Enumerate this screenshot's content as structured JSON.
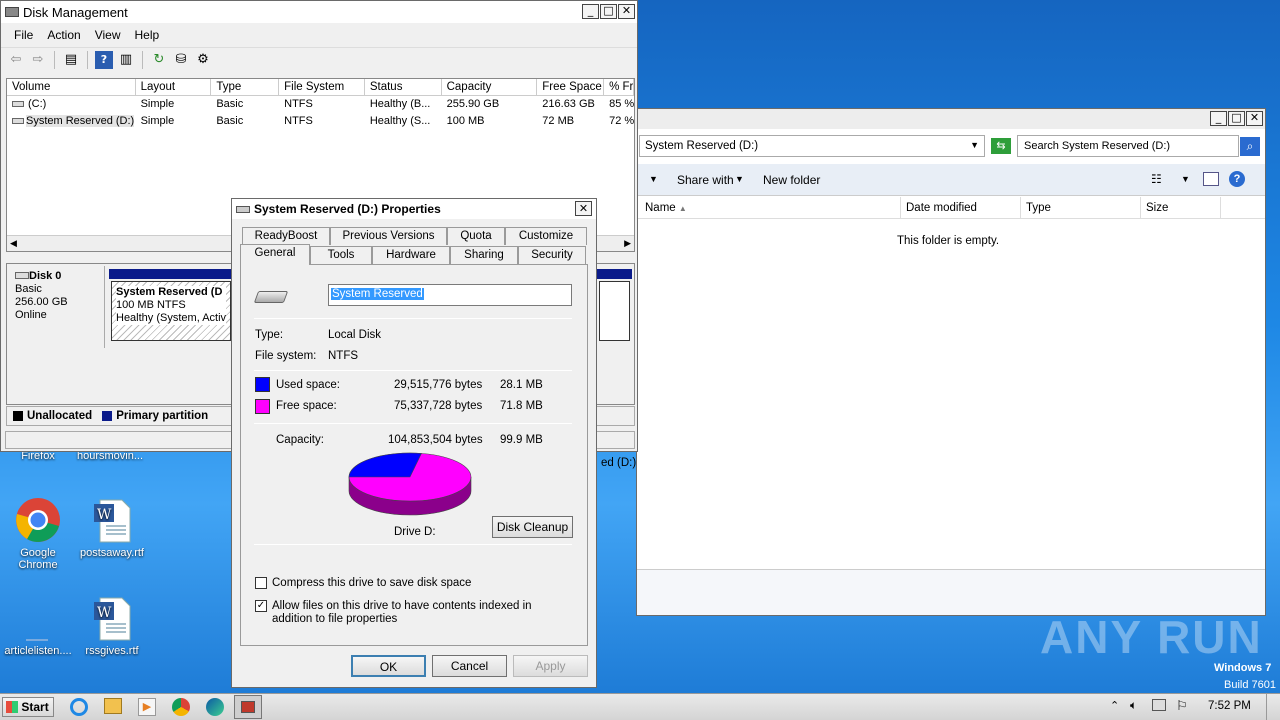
{
  "desktop": {
    "icons": [
      {
        "label": "Firefox"
      },
      {
        "label": "hoursmovin..."
      },
      {
        "label": "Google Chrome"
      },
      {
        "label": "postsaway.rtf"
      },
      {
        "label": "articlelisten...."
      },
      {
        "label": "rssgives.rtf"
      }
    ],
    "watermark": "ANY RUN",
    "os_name": "Windows 7",
    "build": "Build 7601"
  },
  "diskmgmt": {
    "title": "Disk Management",
    "menu": [
      "File",
      "Action",
      "View",
      "Help"
    ],
    "columns": [
      "Volume",
      "Layout",
      "Type",
      "File System",
      "Status",
      "Capacity",
      "Free Space",
      "% Fr"
    ],
    "rows": [
      [
        "(C:)",
        "Simple",
        "Basic",
        "NTFS",
        "Healthy (B...",
        "255.90 GB",
        "216.63 GB",
        "85 %"
      ],
      [
        "System Reserved (D:)",
        "Simple",
        "Basic",
        "NTFS",
        "Healthy (S...",
        "100 MB",
        "72 MB",
        "72 %"
      ]
    ],
    "disk": {
      "name": "Disk 0",
      "type": "Basic",
      "size": "256.00 GB",
      "state": "Online"
    },
    "partition": {
      "name": "System Reserved  (D",
      "size": "100 MB NTFS",
      "status": "Healthy (System, Active"
    },
    "legend": [
      "Unallocated",
      "Primary partition"
    ]
  },
  "explorer": {
    "address": "System Reserved (D:)",
    "search_placeholder": "Search System Reserved (D:)",
    "share_with": "Share with",
    "new_folder": "New folder",
    "columns": [
      "Name",
      "Date modified",
      "Type",
      "Size"
    ],
    "empty": "This folder is empty.",
    "nav_item": "ed (D:)"
  },
  "props": {
    "title": "System Reserved (D:) Properties",
    "tabs_row1": [
      "ReadyBoost",
      "Previous Versions",
      "Quota",
      "Customize"
    ],
    "tabs_row2": [
      "General",
      "Tools",
      "Hardware",
      "Sharing",
      "Security"
    ],
    "label_value": "System Reserved",
    "type_label": "Type:",
    "type_value": "Local Disk",
    "fs_label": "File system:",
    "fs_value": "NTFS",
    "used_label": "Used space:",
    "used_bytes": "29,515,776 bytes",
    "used_mb": "28.1 MB",
    "free_label": "Free space:",
    "free_bytes": "75,337,728 bytes",
    "free_mb": "71.8 MB",
    "cap_label": "Capacity:",
    "cap_bytes": "104,853,504 bytes",
    "cap_mb": "99.9 MB",
    "used_fraction": 0.28,
    "drive_label": "Drive D:",
    "cleanup": "Disk Cleanup",
    "compress": "Compress this drive to save disk space",
    "index": "Allow files on this drive to have contents indexed in addition to file properties",
    "ok": "OK",
    "cancel": "Cancel",
    "apply": "Apply",
    "colors": {
      "used": "#0000ff",
      "free": "#ff00ff"
    }
  },
  "taskbar": {
    "start": "Start",
    "time": "7:52 PM"
  }
}
